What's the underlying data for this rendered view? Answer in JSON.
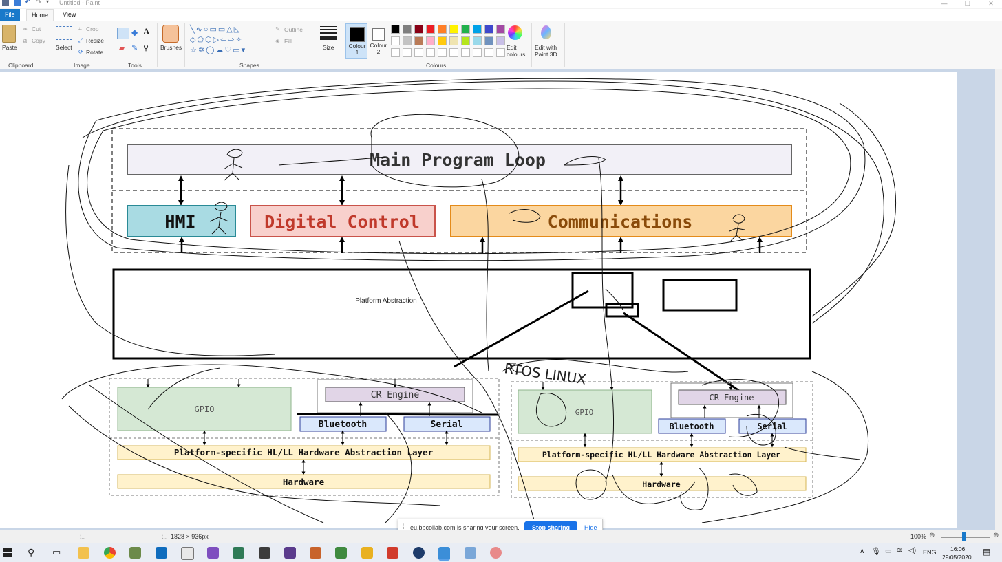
{
  "window": {
    "title": "Untitled - Paint"
  },
  "tabs": {
    "file": "File",
    "home": "Home",
    "view": "View"
  },
  "ribbon": {
    "clipboard": {
      "paste": "Paste",
      "cut": "Cut",
      "copy": "Copy",
      "group": "Clipboard"
    },
    "image": {
      "select": "Select",
      "crop": "Crop",
      "resize": "Resize",
      "rotate": "Rotate",
      "group": "Image"
    },
    "tools": {
      "group": "Tools"
    },
    "brushes": {
      "label": "Brushes"
    },
    "shapes": {
      "outline": "Outline",
      "fill": "Fill",
      "group": "Shapes"
    },
    "size": {
      "label": "Size"
    },
    "colour1": {
      "label": "Colour 1",
      "color": "#000000"
    },
    "colour2": {
      "label": "Colour 2",
      "color": "#ffffff"
    },
    "colours": {
      "group": "Colours",
      "row1": [
        "#000000",
        "#7f7f7f",
        "#880015",
        "#ed1c24",
        "#ff7f27",
        "#fff200",
        "#22b14c",
        "#00a2e8",
        "#3f48cc",
        "#a349a4"
      ],
      "row2": [
        "#ffffff",
        "#c3c3c3",
        "#b97a57",
        "#ffaec9",
        "#ffc90e",
        "#efe4b0",
        "#b5e61d",
        "#99d9ea",
        "#7092be",
        "#c8bfe7"
      ]
    },
    "edit_colours": "Edit colours",
    "edit_paint3d": "Edit with Paint 3D"
  },
  "diagram": {
    "main_loop": "Main Program Loop",
    "hmi": "HMI",
    "digital_control": "Digital Control",
    "communications": "Communications",
    "platform_abstraction": "Platform Abstraction",
    "left_stack": {
      "gpio": "GPIO",
      "cr_engine": "CR Engine",
      "bluetooth": "Bluetooth",
      "serial": "Serial",
      "hal": "Platform-specific HL/LL Hardware Abstraction Layer",
      "hardware": "Hardware"
    },
    "right_stack": {
      "gpio": "GPIO",
      "cr_engine": "CR Engine",
      "bluetooth": "Bluetooth",
      "serial": "Serial",
      "hal": "Platform-specific HL/LL Hardware Abstraction Layer",
      "hardware": "Hardware"
    },
    "handwriting": "RTOS LINUX",
    "colors": {
      "hmi_fill": "#a9dbe3",
      "hmi_border": "#2a8a96",
      "dc_fill": "#f8d0cc",
      "dc_border": "#c9534a",
      "dc_text": "#c0392b",
      "comm_fill": "#fbd6a0",
      "comm_border": "#e48b1a",
      "comm_text": "#8a4b0a",
      "gpio_fill": "#d5e8d4",
      "cr_fill": "#e1d5e7",
      "bt_fill": "#dae8fc",
      "bt_border": "#2c3e9a",
      "hal_fill": "#fff2cc"
    }
  },
  "status": {
    "dimensions": "1828 × 936px",
    "zoom": "100%"
  },
  "share_bar": {
    "message": "eu.bbcollab.com is sharing your screen.",
    "stop": "Stop sharing",
    "hide": "Hide"
  },
  "taskbar": {
    "lang": "ENG",
    "time": "16:06",
    "date": "29/05/2020"
  }
}
